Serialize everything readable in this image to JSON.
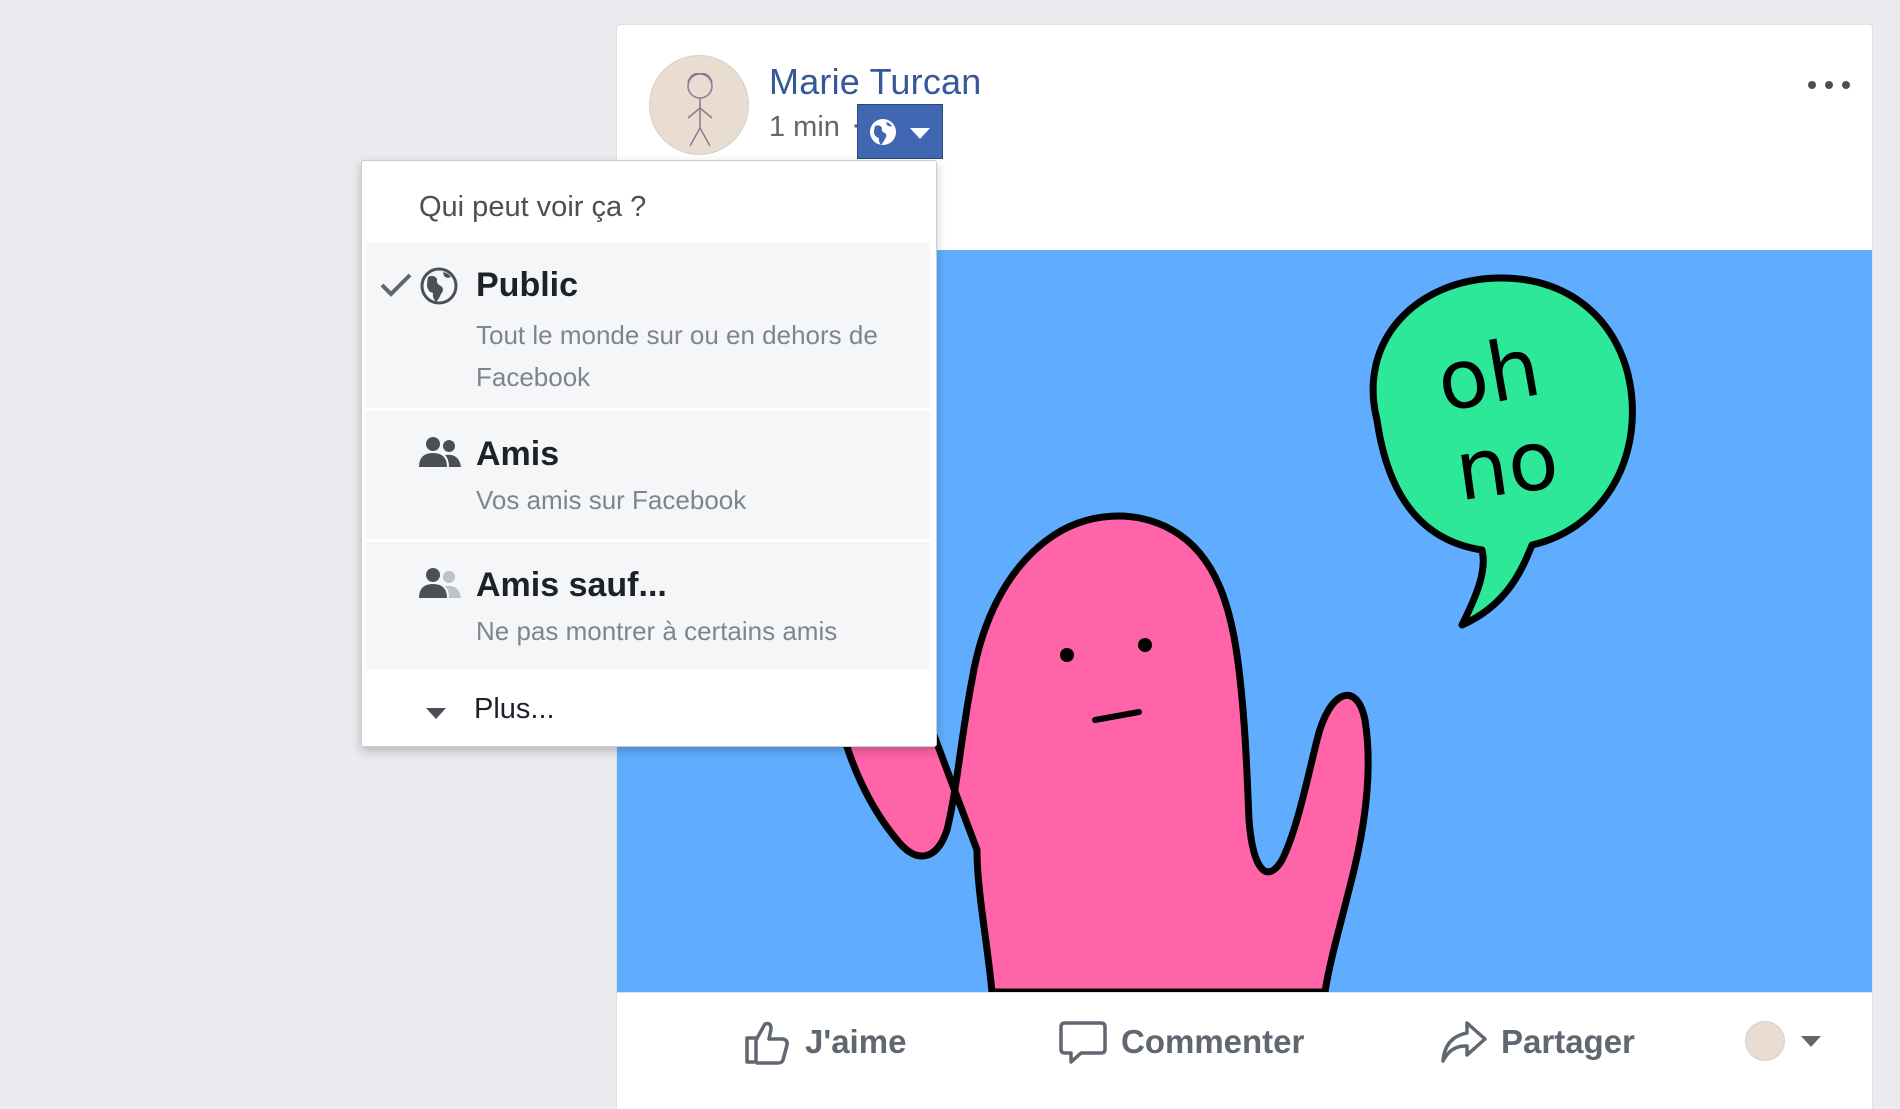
{
  "post": {
    "author_name": "Marie Turcan",
    "timestamp": "1 min",
    "dot_separator": "·",
    "audience_current": "Public",
    "audience_icon": "globe-icon",
    "more_options_icon": "ellipsis-icon",
    "image": {
      "background_color": "#60adff",
      "bubble_color": "#2ee89a",
      "character_color": "#ff64a8",
      "bubble_text_line1": "oh",
      "bubble_text_line2": "no"
    },
    "actions": {
      "like_label": "J'aime",
      "comment_label": "Commenter",
      "share_label": "Partager"
    }
  },
  "audience_menu": {
    "header": "Qui peut voir ça ?",
    "options": [
      {
        "title": "Public",
        "description": "Tout le monde sur ou en dehors de Facebook",
        "icon": "globe-icon",
        "selected": true
      },
      {
        "title": "Amis",
        "description": "Vos amis sur Facebook",
        "icon": "friends-icon",
        "selected": false
      },
      {
        "title": "Amis sauf...",
        "description": "Ne pas montrer à certains amis",
        "icon": "friends-except-icon",
        "selected": false
      }
    ],
    "more_label": "Plus..."
  },
  "colors": {
    "page_background": "#e9ebee",
    "link_blue": "#365899",
    "button_blue": "#4267b2",
    "muted_text": "#616770"
  }
}
